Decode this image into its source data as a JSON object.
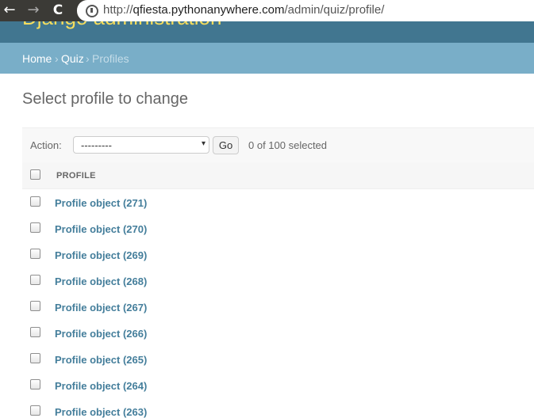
{
  "browser": {
    "back_icon": "←",
    "forward_icon": "→",
    "reload_icon": "C",
    "url_prefix": "http://",
    "url_host": "qfiesta.pythonanywhere.com",
    "url_path": "/admin/quiz/profile/"
  },
  "header": {
    "branding": "Django administration"
  },
  "breadcrumbs": {
    "home": "Home",
    "app": "Quiz",
    "current": "Profiles",
    "separator": "›"
  },
  "page": {
    "title": "Select profile to change"
  },
  "actions": {
    "label": "Action:",
    "selected_option": "---------",
    "arrow": "▾",
    "go_label": "Go",
    "selection_count": "0 of 100 selected"
  },
  "table": {
    "column_header": "PROFILE",
    "rows": [
      {
        "label": "Profile object (271)"
      },
      {
        "label": "Profile object (270)"
      },
      {
        "label": "Profile object (269)"
      },
      {
        "label": "Profile object (268)"
      },
      {
        "label": "Profile object (267)"
      },
      {
        "label": "Profile object (266)"
      },
      {
        "label": "Profile object (265)"
      },
      {
        "label": "Profile object (264)"
      },
      {
        "label": "Profile object (263)"
      }
    ]
  }
}
